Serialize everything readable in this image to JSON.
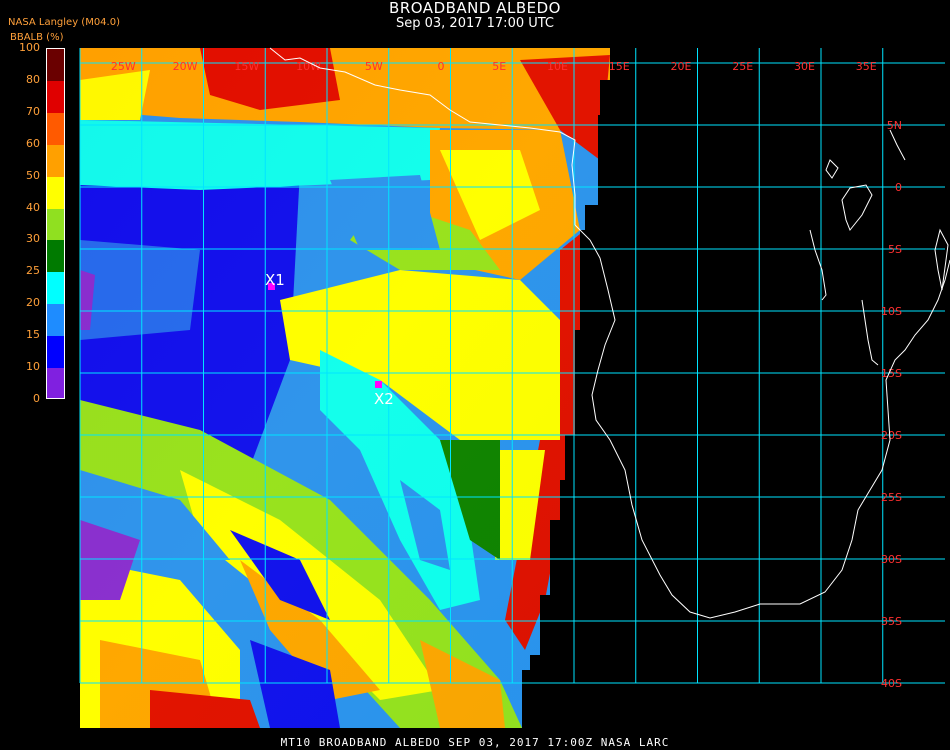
{
  "header": {
    "title": "BROADBAND ALBEDO",
    "subtitle": "Sep 03, 2017 17:00 UTC",
    "source": "NASA Langley (M04.0)"
  },
  "colorbar": {
    "label": "BBALB (%)",
    "ticks": [
      "100",
      "80",
      "70",
      "60",
      "50",
      "40",
      "30",
      "25",
      "20",
      "15",
      "10",
      "0"
    ],
    "colors": [
      "#6a0000",
      "#e00000",
      "#ff5a00",
      "#ffa000",
      "#ffff00",
      "#90e020",
      "#007a00",
      "#00ffff",
      "#1e8cff",
      "#0000ff",
      "#8020e0"
    ]
  },
  "map": {
    "lon_labels": [
      "25W",
      "20W",
      "15W",
      "10W",
      "5W",
      "0",
      "5E",
      "10E",
      "15E",
      "20E",
      "25E",
      "30E",
      "35E"
    ],
    "lat_labels": [
      "5N",
      "0",
      "5S",
      "10S",
      "15S",
      "20S",
      "25S",
      "30S",
      "35S",
      "40S"
    ],
    "grid_color": "#00e5ff",
    "coast_color": "#ffffff",
    "markers": [
      {
        "label": "X1",
        "color": "#ff00ff"
      },
      {
        "label": "X2",
        "color": "#ff00ff"
      }
    ]
  },
  "footer": {
    "text": "MT10  BROADBAND ALBEDO   SEP 03, 2017 17:00Z   NASA LARC"
  }
}
